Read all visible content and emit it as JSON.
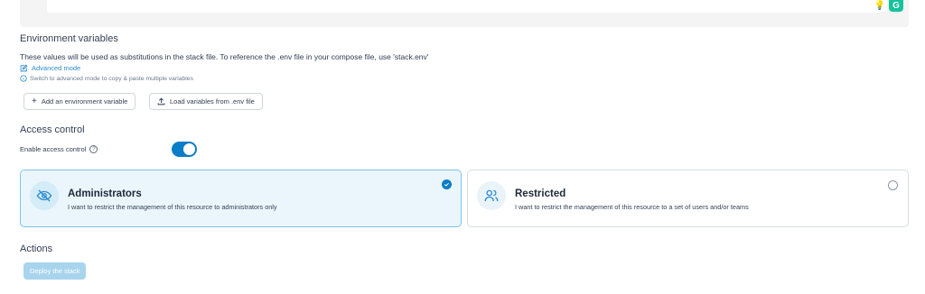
{
  "editor": {
    "extensions": [
      {
        "name": "lightbulb-icon",
        "glyph": "💡"
      },
      {
        "name": "grammarly-icon",
        "glyph": "G"
      }
    ]
  },
  "env": {
    "title": "Environment variables",
    "description": "These values will be used as substitutions in the stack file. To reference the .env file in your compose file, use 'stack.env'",
    "advanced_mode_label": "Advanced mode",
    "hint": "Switch to advanced mode to copy & paste multiple variables",
    "add_button": "Add an environment variable",
    "load_button": "Load variables from .env file"
  },
  "access": {
    "title": "Access control",
    "enable_label": "Enable access control",
    "help_glyph": "?",
    "enabled": true,
    "options": [
      {
        "title": "Administrators",
        "description": "I want to restrict the management of this resource to administrators only",
        "selected": true,
        "icon": "eye-off-icon"
      },
      {
        "title": "Restricted",
        "description": "I want to restrict the management of this resource to a set of users and/or teams",
        "selected": false,
        "icon": "users-icon"
      }
    ]
  },
  "actions": {
    "title": "Actions",
    "deploy_label": "Deploy the stack"
  },
  "colors": {
    "accent": "#0b7cc7",
    "link": "#2d8bd0",
    "selected_bg": "#eaf6fc",
    "selected_border": "#7cc5ea",
    "deploy_disabled": "#a9d4ee"
  }
}
